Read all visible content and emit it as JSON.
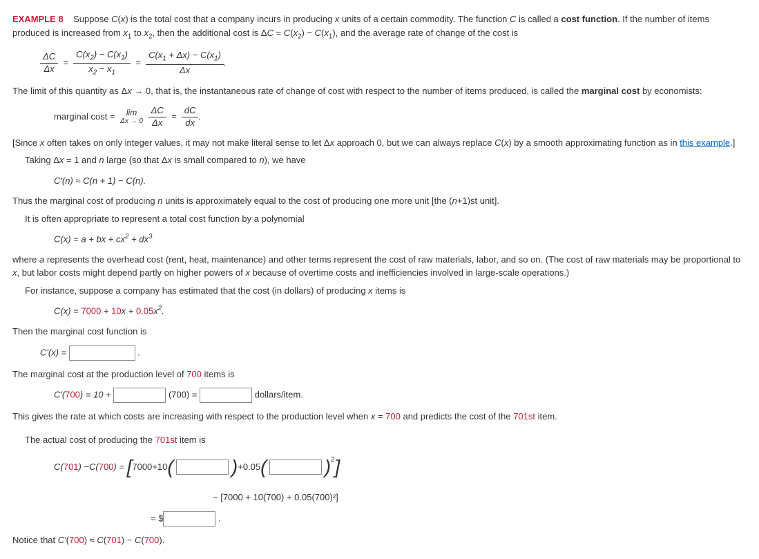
{
  "example_label": "EXAMPLE 8",
  "intro_a": "Suppose ",
  "intro_b": " is the total cost that a company incurs in producing ",
  "intro_c": " units of a certain commodity. The function ",
  "intro_d": " is called a ",
  "cost_function": "cost function",
  "intro_e": ". If the number of items produced is increased from ",
  "intro_f": " to ",
  "intro_g": ", then the additional cost is ",
  "intro_h": ", and the average rate of change of the cost is",
  "limit_text_a": "The limit of this quantity as ",
  "limit_text_b": ", that is, the instantaneous rate of change of cost with respect to the number of items produced, is called the ",
  "marginal_cost": "marginal cost",
  "limit_text_c": " by economists:",
  "mc_label": "marginal cost =",
  "since_a": "[Since ",
  "since_b": " often takes on only integer values, it may not make literal sense to let ",
  "since_c": " approach 0, but we can always replace ",
  "since_d": " by a smooth approximating function as in ",
  "this_example": "this example",
  "since_e": ".]",
  "taking_a": "Taking ",
  "taking_b": " and ",
  "taking_c": " large (so that ",
  "taking_d": " is small compared to ",
  "taking_e": "), we have",
  "thus_a": "Thus the marginal cost of producing ",
  "thus_b": " units is approximately equal to the cost of producing one more unit [the (",
  "thus_c": "+1)st unit].",
  "often": "It is often appropriate to represent a total cost function by a polynomial",
  "where_a": "where ",
  "where_b": " represents the overhead cost (rent, heat, maintenance) and other terms represent the cost of raw materials, labor, and so on. (The cost of raw materials may be proportional to ",
  "where_c": ", but labor costs might depend partly on higher powers of ",
  "where_d": " because of overtime costs and inefficiencies involved in large-scale operations.)",
  "for_instance": "For instance, suppose a company has estimated that the cost (in dollars) of producing ",
  "for_instance_b": " items is",
  "cost_coef_a": "7000",
  "cost_coef_b": "10",
  "cost_coef_c": "0.05",
  "then_marginal": "Then the marginal cost function is",
  "marg_at_a": "The marginal cost at the production level of ",
  "n700": "700",
  "marg_at_b": " items is",
  "c700eq": "(700) = ",
  "dollars_item": " dollars/item.",
  "gives_rate_a": "This gives the rate at which costs are increasing with respect to the production level when ",
  "gives_rate_b": " and predicts the cost of the ",
  "n701st": "701st",
  "gives_rate_c": " item.",
  "actual_a": "The actual cost of producing the ",
  "actual_b": " item is",
  "minus_line": "− [7000 + 10(700) + 0.05(700)²]",
  "eq_dollar": "=  $",
  "notice": "Notice that "
}
